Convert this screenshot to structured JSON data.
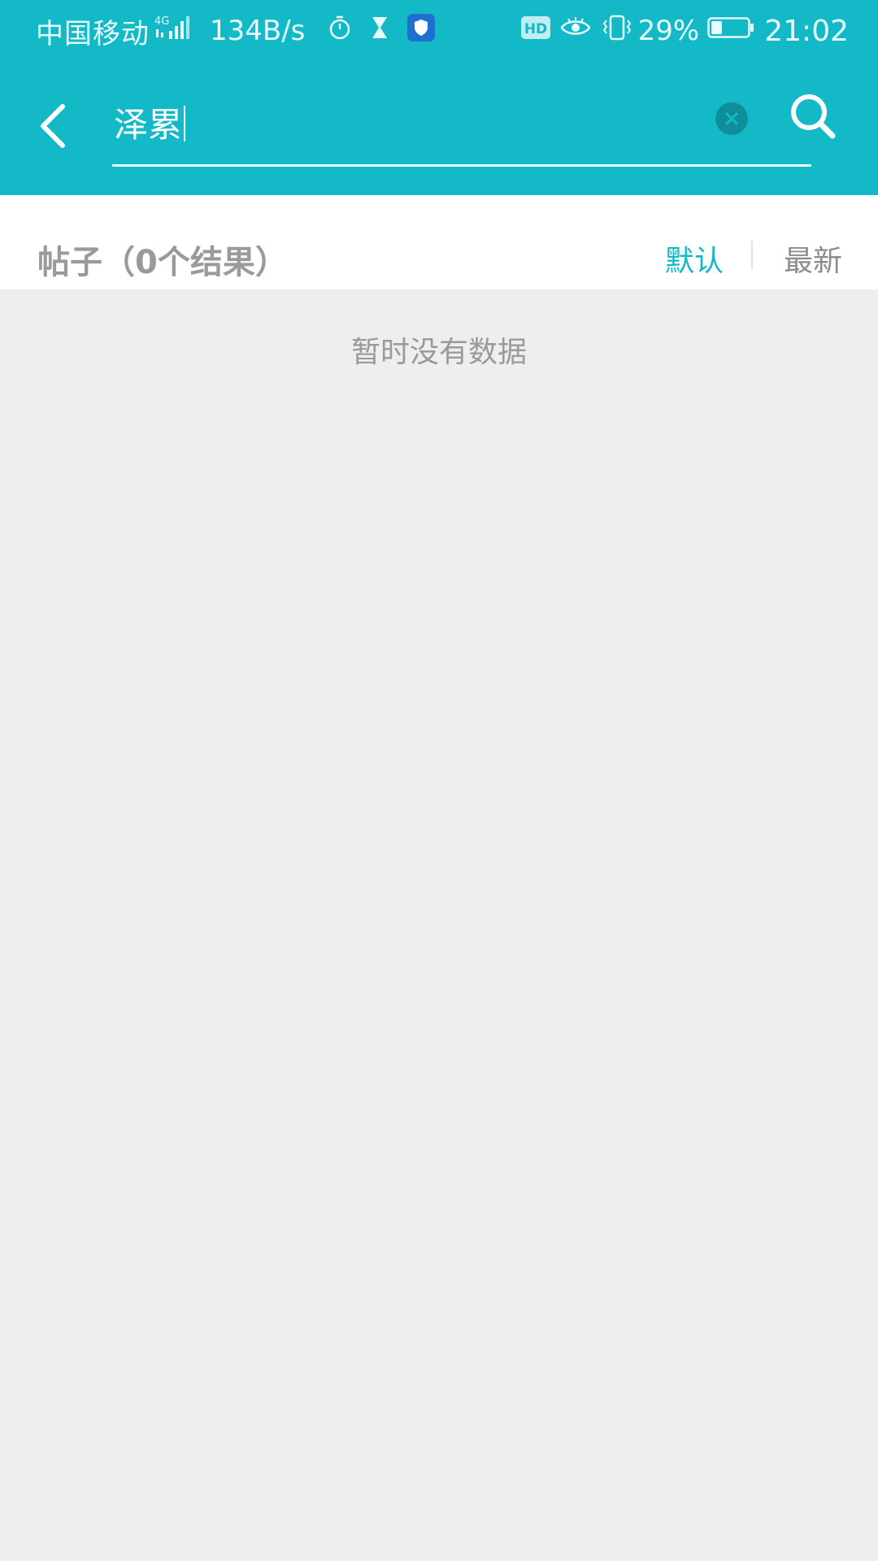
{
  "status_bar": {
    "carrier": "中国移动",
    "network": "4G",
    "speed": "134B/s",
    "battery_percent": "29%",
    "time": "21:02",
    "hd_badge": "HD",
    "icons": [
      "signal-icon",
      "timer-icon",
      "hourglass-icon",
      "shield-app-icon",
      "hd-icon",
      "eye-icon",
      "vibrate-icon",
      "battery-icon"
    ]
  },
  "search": {
    "value": "泽累",
    "clear_icon": "clear-icon",
    "search_icon": "search-icon",
    "back_icon": "back-arrow-icon"
  },
  "results": {
    "title": "帖子（0个结果）",
    "sort_default": "默认",
    "sort_latest": "最新",
    "active_sort": "默认"
  },
  "empty_state": {
    "message": "暂时没有数据"
  },
  "colors": {
    "header": "#14b9c7",
    "accent": "#14b9c7",
    "background": "#eeeeee",
    "muted_text": "#9a9a9a"
  }
}
